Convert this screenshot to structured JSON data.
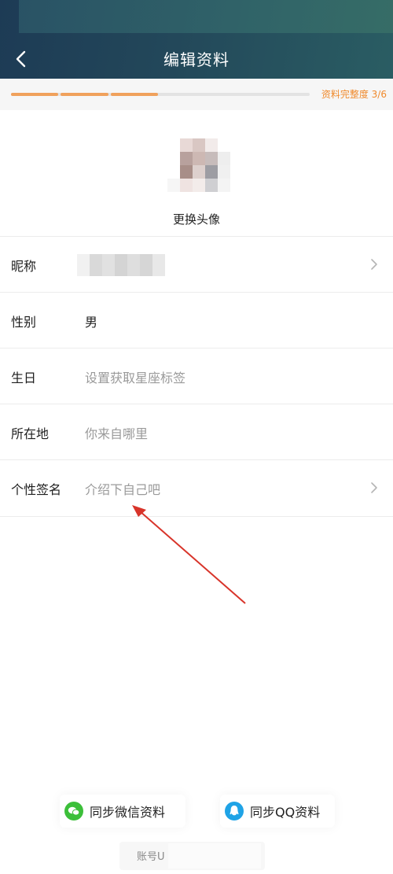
{
  "header": {
    "title": "编辑资料",
    "icons": {
      "back": "chevron-left-icon"
    },
    "colors": {
      "gradient_start": "#1d3b55",
      "gradient_end": "#2a5d63"
    }
  },
  "progress": {
    "label": "资料完整度 3/6",
    "completed": 3,
    "total": 6,
    "fill_color": "#f0a15c"
  },
  "avatar": {
    "change_label": "更换头像"
  },
  "fields": [
    {
      "label": "昵称",
      "value": "",
      "placeholder": ""
    },
    {
      "label": "性别",
      "value": "男",
      "placeholder": ""
    },
    {
      "label": "生日",
      "value": "",
      "placeholder": "设置获取星座标签"
    },
    {
      "label": "所在地",
      "value": "",
      "placeholder": "你来自哪里"
    },
    {
      "label": "个性签名",
      "value": "",
      "placeholder": "介绍下自己吧"
    }
  ],
  "sync": {
    "wechat_label": "同步微信资料",
    "qq_label": "同步QQ资料",
    "icons": {
      "wechat": "wechat-icon",
      "qq": "qq-icon"
    }
  },
  "account": {
    "label": "账号U"
  }
}
